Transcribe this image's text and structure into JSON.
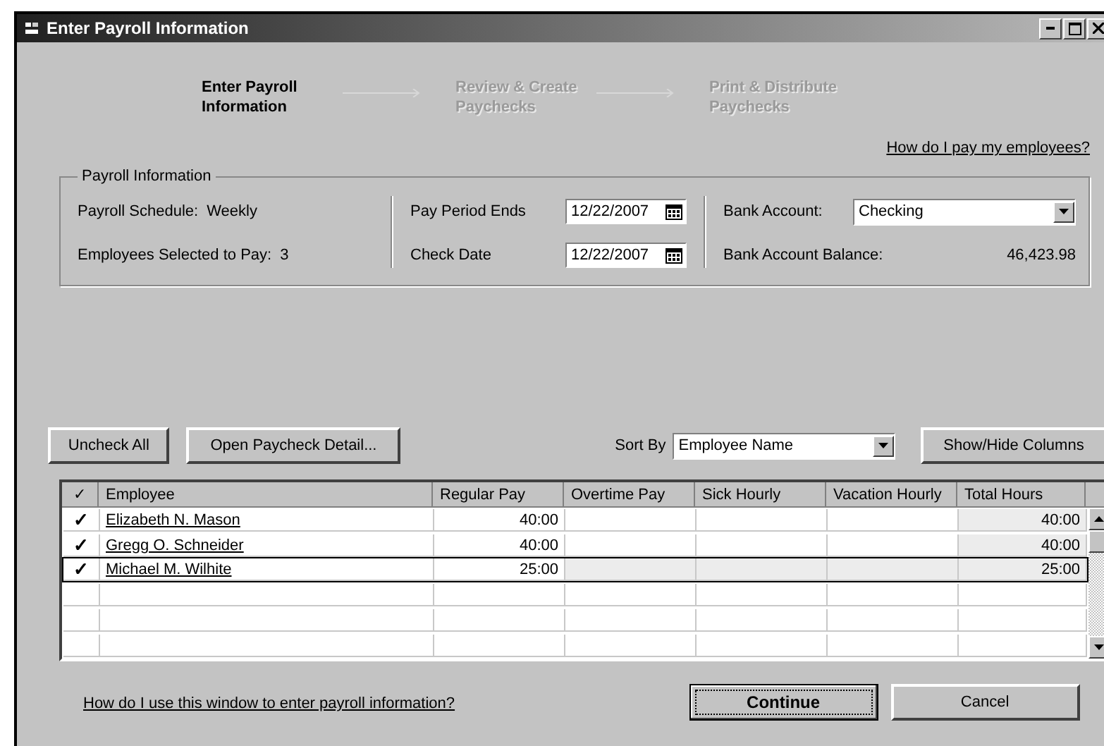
{
  "window": {
    "title": "Enter Payroll Information"
  },
  "steps": [
    {
      "label": "Enter Payroll Information",
      "selected": true
    },
    {
      "label": "Review & Create Paychecks",
      "selected": false
    },
    {
      "label": "Print & Distribute Paychecks",
      "selected": false
    }
  ],
  "help_link": "How do I pay my employees?",
  "payroll_info": {
    "title": "Payroll Information",
    "schedule_label": "Payroll Schedule:",
    "schedule": "Weekly",
    "selected_label": "Employees Selected to Pay:",
    "selected_count": "3",
    "period_label": "Pay Period Ends",
    "period_value": "12/22/2007",
    "check_label": "Check Date",
    "check_value": "12/22/2007",
    "bank_label": "Bank Account:",
    "bank_value": "Checking",
    "balance_label": "Bank Account Balance:",
    "balance": "46,423.98"
  },
  "toolbar": {
    "uncheck": "Uncheck All",
    "open_detail": "Open Paycheck Detail...",
    "sort_label": "Sort By",
    "sort_value": "Employee Name",
    "show_hide": "Show/Hide Columns"
  },
  "table": {
    "check_header": "✓",
    "columns": [
      "Employee",
      "Regular Pay",
      "Overtime Pay",
      "Sick Hourly",
      "Vacation Hourly",
      "Total Hours"
    ],
    "rows": [
      {
        "checked": true,
        "selected": false,
        "cells": [
          "Elizabeth N. Mason",
          "40:00",
          "",
          "",
          "",
          "40:00"
        ]
      },
      {
        "checked": true,
        "selected": false,
        "cells": [
          "Gregg O. Schneider",
          "40:00",
          "",
          "",
          "",
          "40:00"
        ]
      },
      {
        "checked": true,
        "selected": true,
        "cells": [
          "Michael M. Wilhite",
          "25:00",
          "",
          "",
          "",
          "25:00"
        ]
      }
    ]
  },
  "footer": {
    "help_link": "How do I use this window to enter payroll information?",
    "continue": "Continue",
    "cancel": "Cancel"
  }
}
